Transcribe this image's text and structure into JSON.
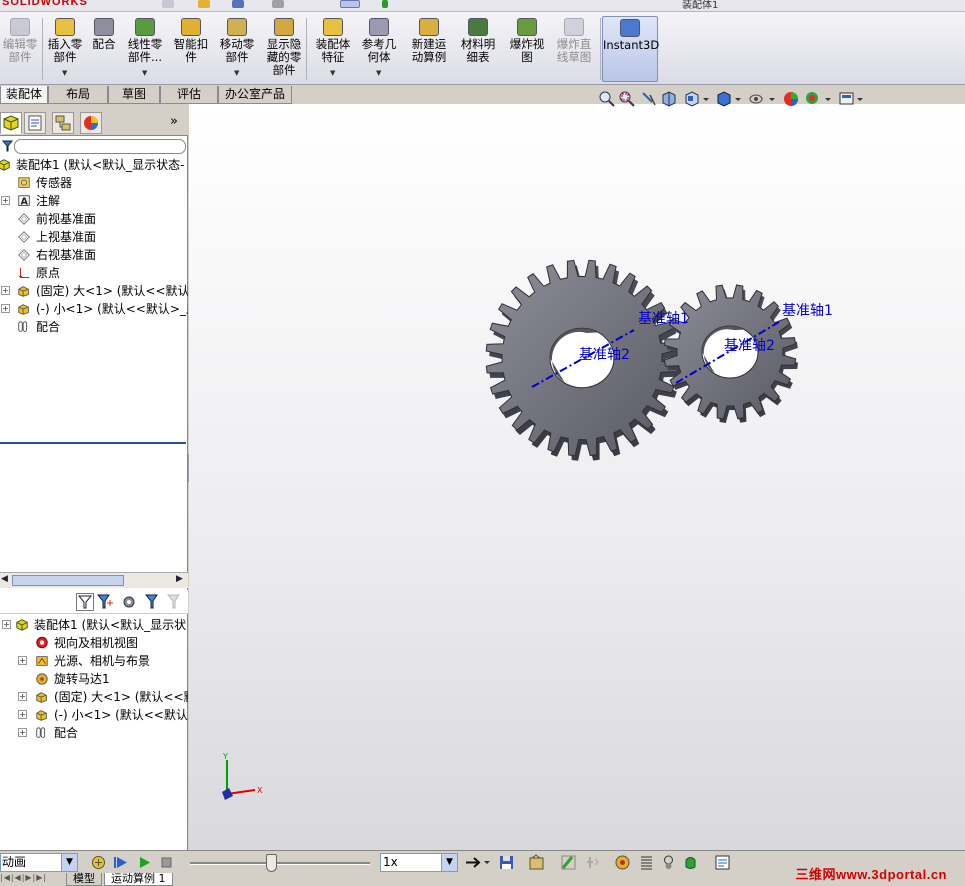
{
  "app": {
    "brand": "SOLIDWORKS",
    "doc_title": "装配体1"
  },
  "command_manager": {
    "buttons": [
      {
        "label": "编辑零\n部件",
        "enabled": false,
        "icon": "edit-component-icon"
      },
      {
        "label": "插入零\n部件",
        "enabled": true,
        "dropdown": true,
        "icon": "insert-component-icon"
      },
      {
        "label": "配合",
        "enabled": true,
        "icon": "mate-icon"
      },
      {
        "label": "线性零\n部件...",
        "enabled": true,
        "dropdown": true,
        "icon": "linear-pattern-icon"
      },
      {
        "label": "智能扣\n件",
        "enabled": true,
        "icon": "smart-fasteners-icon"
      },
      {
        "label": "移动零\n部件",
        "enabled": true,
        "dropdown": true,
        "icon": "move-component-icon"
      },
      {
        "label": "显示隐\n藏的零\n部件",
        "enabled": true,
        "icon": "show-hidden-components-icon"
      },
      {
        "label": "装配体\n特征",
        "enabled": true,
        "dropdown": true,
        "icon": "assembly-features-icon"
      },
      {
        "label": "参考几\n何体",
        "enabled": true,
        "dropdown": true,
        "icon": "reference-geometry-icon"
      },
      {
        "label": "新建运\n动算例",
        "enabled": true,
        "icon": "new-motion-study-icon"
      },
      {
        "label": "材料明\n细表",
        "enabled": true,
        "icon": "bill-of-materials-icon"
      },
      {
        "label": "爆炸视\n图",
        "enabled": true,
        "icon": "exploded-view-icon"
      },
      {
        "label": "爆炸直\n线草图",
        "enabled": false,
        "icon": "explode-line-sketch-icon"
      },
      {
        "label": "Instant3D",
        "enabled": true,
        "active": true,
        "icon": "instant3d-icon"
      }
    ],
    "tabs": [
      "装配体",
      "布局",
      "草图",
      "评估",
      "办公室产品"
    ],
    "active_tab": "装配体"
  },
  "feature_manager": {
    "tree": [
      {
        "label": "装配体1   (默认<默认_显示状态-",
        "icon": "assembly-icon",
        "expander": false,
        "indent": 0
      },
      {
        "label": "传感器",
        "icon": "sensor-icon",
        "expander": false,
        "indent": 1
      },
      {
        "label": "注解",
        "icon": "annotation-icon",
        "expander": true,
        "indent": 1
      },
      {
        "label": "前视基准面",
        "icon": "plane-icon",
        "expander": false,
        "indent": 1
      },
      {
        "label": "上视基准面",
        "icon": "plane-icon",
        "expander": false,
        "indent": 1
      },
      {
        "label": "右视基准面",
        "icon": "plane-icon",
        "expander": false,
        "indent": 1
      },
      {
        "label": "原点",
        "icon": "origin-icon",
        "expander": false,
        "indent": 1
      },
      {
        "label": "(固定) 大<1> (默认<<默认>_",
        "icon": "part-icon",
        "expander": true,
        "indent": 1
      },
      {
        "label": "(-) 小<1> (默认<<默认>_显",
        "icon": "part-icon",
        "expander": true,
        "indent": 1
      },
      {
        "label": "配合",
        "icon": "mates-folder-icon",
        "expander": false,
        "indent": 1
      }
    ]
  },
  "motion_manager": {
    "tree": [
      {
        "label": "装配体1   (默认<默认_显示状",
        "icon": "assembly-icon",
        "expander": true,
        "indent": 0
      },
      {
        "label": "视向及相机视图",
        "icon": "camera-views-icon",
        "expander": false,
        "indent": 1
      },
      {
        "label": "光源、相机与布景",
        "icon": "lights-scene-icon",
        "expander": true,
        "indent": 1
      },
      {
        "label": "旋转马达1",
        "icon": "rotary-motor-icon",
        "expander": false,
        "indent": 1
      },
      {
        "label": "(固定) 大<1> (默认<<默",
        "icon": "part-icon",
        "expander": true,
        "indent": 1
      },
      {
        "label": "(-) 小<1> (默认<<默认>",
        "icon": "part-icon",
        "expander": true,
        "indent": 1
      },
      {
        "label": "配合",
        "icon": "mates-folder-icon",
        "expander": true,
        "indent": 1
      }
    ]
  },
  "graphics": {
    "labels": {
      "axis1_small": "基准轴1",
      "axis2_small": "基准轴2",
      "axis1_large": "基准轴1",
      "axis2_large": "基准轴2"
    },
    "triad": {
      "x": "X",
      "y": "Y"
    },
    "colors": {
      "gear": "#6e6e78",
      "axis": "#0000cc",
      "triad_x": "#e00000",
      "triad_y": "#00a000"
    }
  },
  "motion_bar": {
    "study_type": "动画",
    "playback_speed": "1x",
    "timeline_position": 0.45
  },
  "status_tabs": [
    "模型",
    "运动算例 1"
  ],
  "active_status_tab": "运动算例 1",
  "watermark": "三维网www.3dportal.cn"
}
